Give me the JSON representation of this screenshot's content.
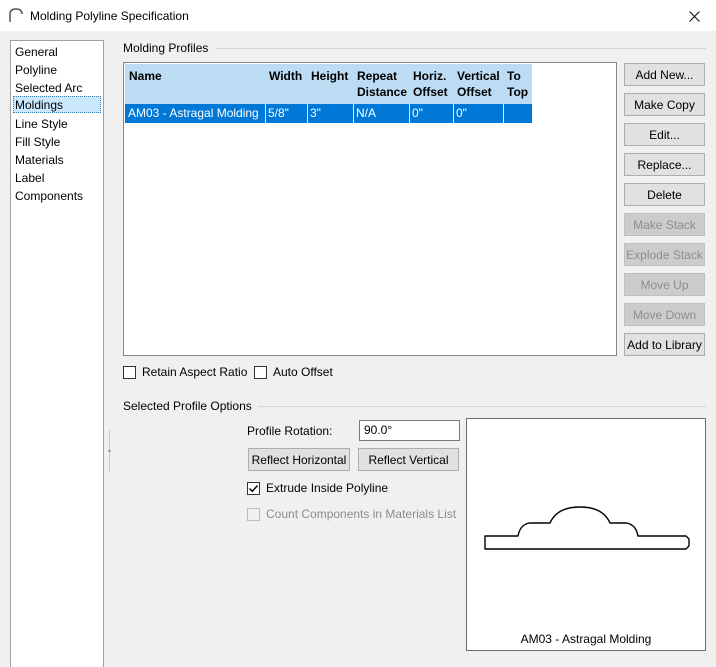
{
  "window": {
    "title": "Molding Polyline Specification"
  },
  "sidebar": {
    "items": [
      {
        "label": "General"
      },
      {
        "label": "Polyline"
      },
      {
        "label": "Selected Arc"
      },
      {
        "label": "Moldings",
        "selected": true
      },
      {
        "label": "Line Style"
      },
      {
        "label": "Fill Style"
      },
      {
        "label": "Materials"
      },
      {
        "label": "Label"
      },
      {
        "label": "Components"
      }
    ]
  },
  "profiles_group": {
    "title": "Molding Profiles",
    "columns": [
      {
        "line1": "",
        "line2": "Name"
      },
      {
        "line1": "",
        "line2": "Width"
      },
      {
        "line1": "",
        "line2": "Height"
      },
      {
        "line1": "Repeat",
        "line2": "Distance"
      },
      {
        "line1": "Horiz.",
        "line2": "Offset"
      },
      {
        "line1": "Vertical",
        "line2": "Offset"
      },
      {
        "line1": "To",
        "line2": "Top"
      }
    ],
    "rows": [
      {
        "name": "AM03 - Astragal Molding",
        "width": "5/8\"",
        "height": "3\"",
        "repeat": "N/A",
        "horiz": "0\"",
        "vertical": "0\"",
        "to_top": ""
      }
    ]
  },
  "buttons": {
    "add_new": "Add New...",
    "make_copy": "Make Copy",
    "edit": "Edit...",
    "replace": "Replace...",
    "delete": "Delete",
    "make_stack": "Make Stack",
    "explode_stack": "Explode Stack",
    "move_up": "Move Up",
    "move_down": "Move Down",
    "add_to_library": "Add to Library"
  },
  "options": {
    "retain_aspect_ratio": {
      "label": "Retain Aspect Ratio",
      "checked": false
    },
    "auto_offset": {
      "label": "Auto Offset",
      "checked": false
    }
  },
  "selected_profile": {
    "title": "Selected Profile Options",
    "rotation_label": "Profile Rotation:",
    "rotation_value": "90.0°",
    "reflect_horizontal": "Reflect Horizontal",
    "reflect_vertical": "Reflect Vertical",
    "extrude_inside": {
      "label": "Extrude Inside Polyline",
      "checked": true
    },
    "count_components": {
      "label": "Count Components in Materials List",
      "checked": false,
      "disabled": true
    },
    "preview_caption": "AM03 - Astragal Molding"
  }
}
